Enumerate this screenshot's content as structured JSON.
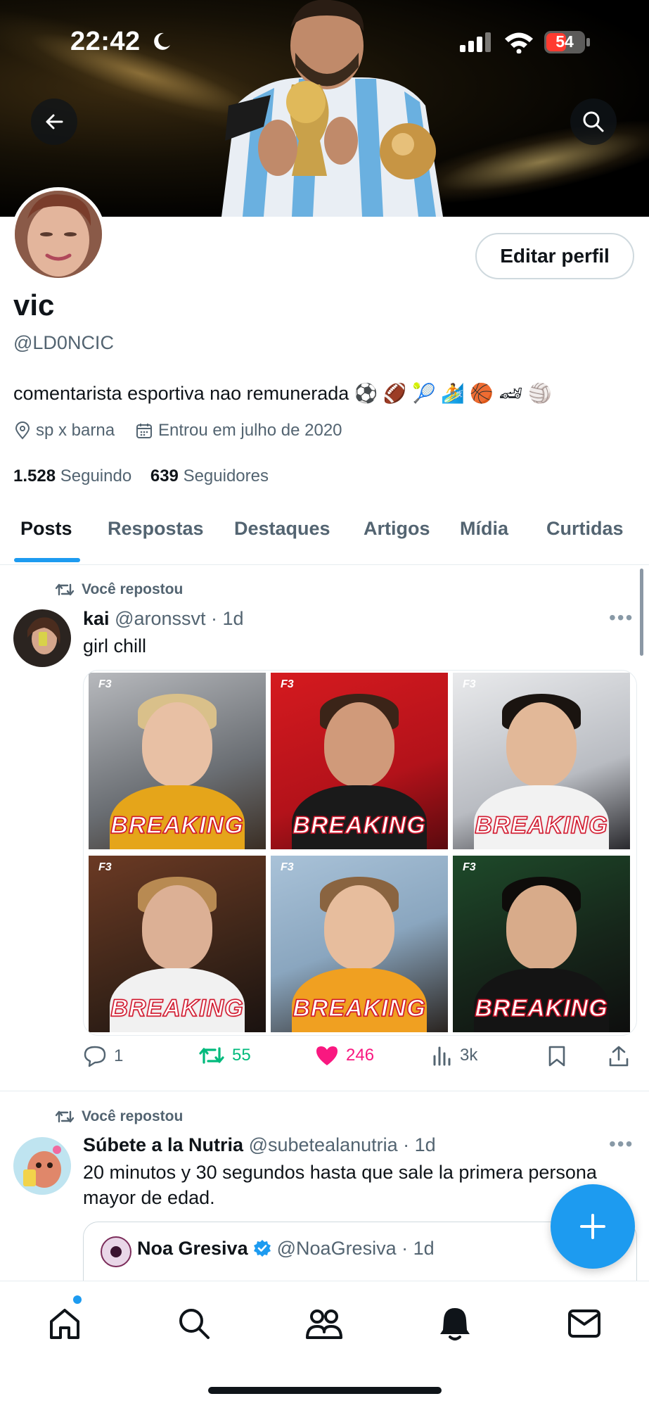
{
  "status_bar": {
    "time": "22:42",
    "battery": "54"
  },
  "profile": {
    "name": "vic",
    "handle": "@LD0NCIC",
    "bio": "comentarista esportiva nao remunerada ⚽ 🏈 🎾 🏄 🏀 🏎 🏐",
    "location": "sp x barna",
    "joined": "Entrou em julho de 2020",
    "following_count": "1.528",
    "following_label": "Seguindo",
    "followers_count": "639",
    "followers_label": "Seguidores",
    "edit_button": "Editar perfil"
  },
  "tabs": [
    "Posts",
    "Respostas",
    "Destaques",
    "Artigos",
    "Mídia",
    "Curtidas"
  ],
  "active_tab": "Posts",
  "posts": [
    {
      "repost_label": "Você repostou",
      "author_name": "kai",
      "author_handle": "@aronssvt",
      "time": "· 1d",
      "text": "girl chill",
      "images_caption": "BREAKING",
      "images_logo": "F3",
      "stats": {
        "replies": "1",
        "reposts": "55",
        "likes": "246",
        "views": "3k"
      }
    },
    {
      "repost_label": "Você repostou",
      "author_name": "Súbete a la Nutria",
      "author_handle": "@subetealanutria",
      "time": "· 1d",
      "text": "20 minutos y 30 segundos hasta que sale la primera persona mayor de edad.",
      "quote": {
        "author_name": "Noa Gresiva",
        "author_handle": "@NoaGresiva",
        "time": "· 1d"
      }
    }
  ],
  "colors": {
    "accent": "#1d9bf0",
    "like": "#f91880",
    "repost": "#00ba7c",
    "muted": "#536471"
  },
  "icons": [
    "back-arrow-icon",
    "search-icon",
    "location-pin-icon",
    "calendar-icon",
    "repost-icon",
    "reply-icon",
    "like-icon",
    "views-icon",
    "bookmark-icon",
    "share-icon",
    "more-icon",
    "plus-icon",
    "home-icon",
    "explore-icon",
    "communities-icon",
    "notifications-icon",
    "messages-icon"
  ]
}
